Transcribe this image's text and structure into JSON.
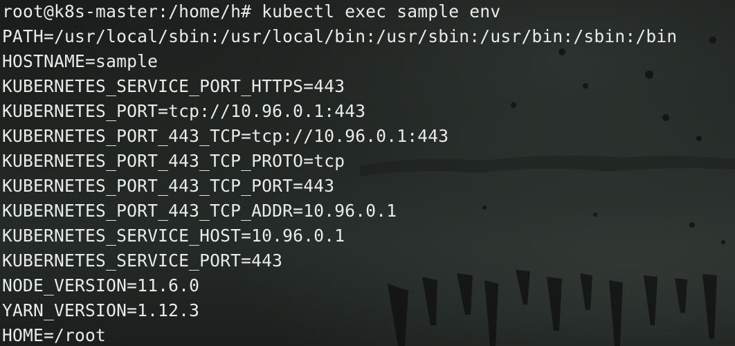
{
  "terminal": {
    "lines": [
      "root@k8s-master:/home/h# kubectl exec sample env",
      "PATH=/usr/local/sbin:/usr/local/bin:/usr/sbin:/usr/bin:/sbin:/bin",
      "HOSTNAME=sample",
      "KUBERNETES_SERVICE_PORT_HTTPS=443",
      "KUBERNETES_PORT=tcp://10.96.0.1:443",
      "KUBERNETES_PORT_443_TCP=tcp://10.96.0.1:443",
      "KUBERNETES_PORT_443_TCP_PROTO=tcp",
      "KUBERNETES_PORT_443_TCP_PORT=443",
      "KUBERNETES_PORT_443_TCP_ADDR=10.96.0.1",
      "KUBERNETES_SERVICE_HOST=10.96.0.1",
      "KUBERNETES_SERVICE_PORT=443",
      "NODE_VERSION=11.6.0",
      "YARN_VERSION=1.12.3",
      "HOME=/root"
    ],
    "colors": {
      "background": "#1a1e1c",
      "text": "#e9ecea"
    }
  }
}
